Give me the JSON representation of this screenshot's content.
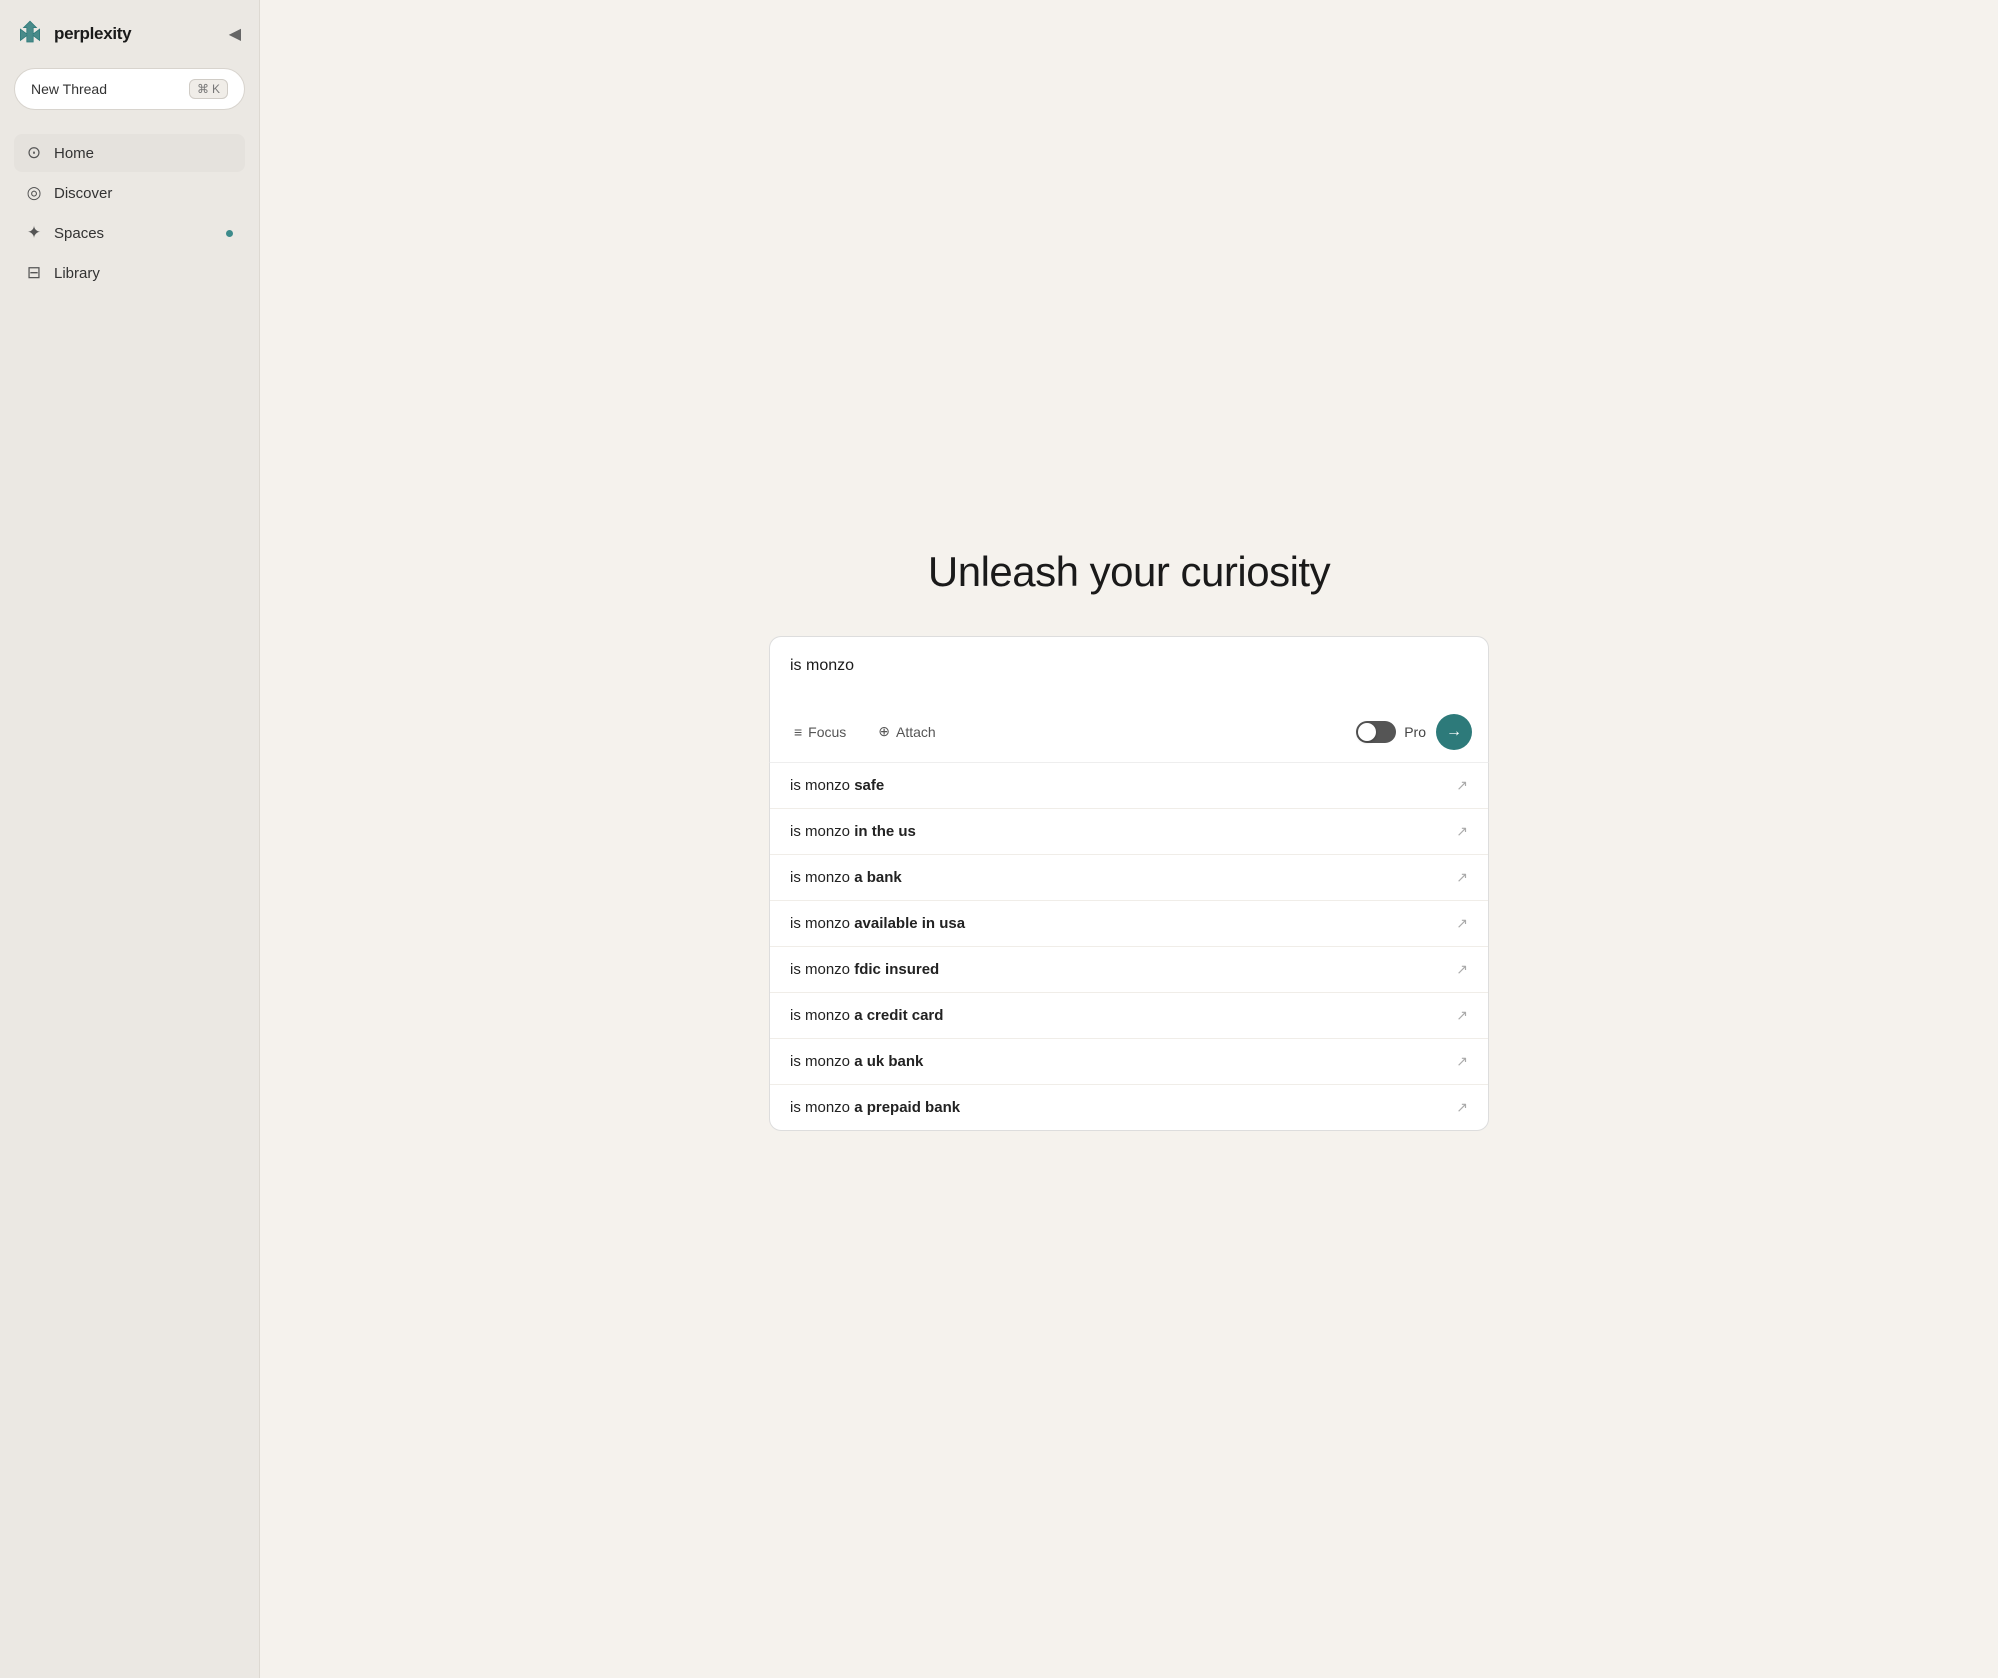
{
  "app": {
    "name": "perplexity",
    "logo_alt": "Perplexity logo"
  },
  "sidebar": {
    "collapse_icon": "◀",
    "new_thread": {
      "label": "New Thread",
      "shortcut_cmd": "⌘",
      "shortcut_key": "K"
    },
    "nav_items": [
      {
        "id": "home",
        "label": "Home",
        "icon": "⊙",
        "active": true,
        "dot": false
      },
      {
        "id": "discover",
        "label": "Discover",
        "icon": "◉",
        "active": false,
        "dot": false
      },
      {
        "id": "spaces",
        "label": "Spaces",
        "icon": "✦",
        "active": false,
        "dot": true
      },
      {
        "id": "library",
        "label": "Library",
        "icon": "⊞",
        "active": false,
        "dot": false
      }
    ]
  },
  "main": {
    "headline": "Unleash your curiosity",
    "search": {
      "input_value": "is monzo",
      "focus_label": "Focus",
      "attach_label": "Attach",
      "pro_label": "Pro",
      "submit_icon": "→"
    },
    "autocomplete": [
      {
        "query": "is monzo ",
        "suffix": "safe"
      },
      {
        "query": "is monzo ",
        "suffix": "in the us"
      },
      {
        "query": "is monzo ",
        "suffix": "a bank"
      },
      {
        "query": "is monzo ",
        "suffix": "available in usa"
      },
      {
        "query": "is monzo ",
        "suffix": "fdic insured"
      },
      {
        "query": "is monzo ",
        "suffix": "a credit card"
      },
      {
        "query": "is monzo ",
        "suffix": "a uk bank"
      },
      {
        "query": "is monzo ",
        "suffix": "a prepaid bank"
      }
    ]
  },
  "colors": {
    "accent": "#2d7a7a",
    "dot": "#3d8b8b"
  }
}
